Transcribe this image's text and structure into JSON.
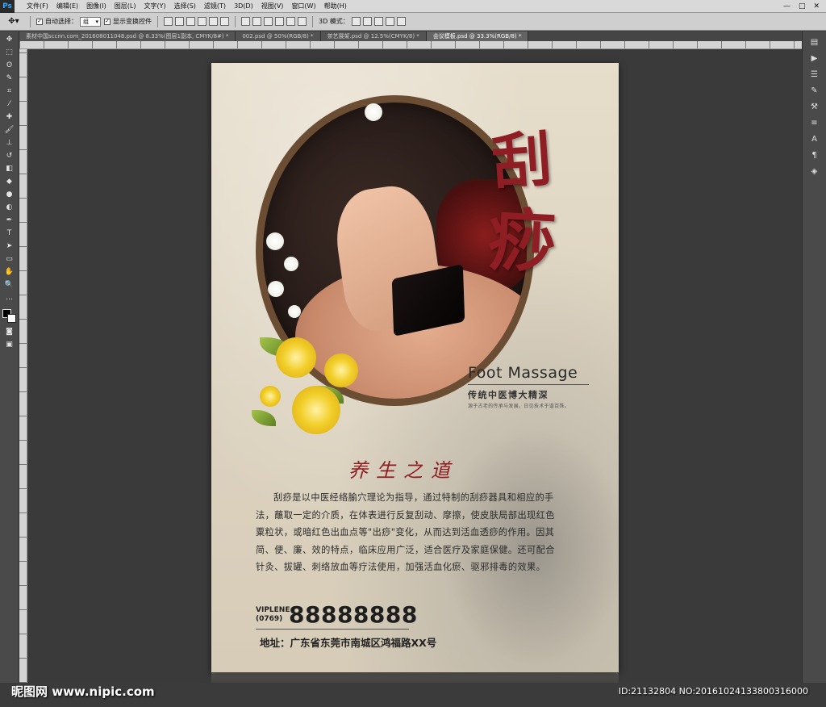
{
  "app": {
    "logo": "Ps"
  },
  "menu": [
    "文件(F)",
    "编辑(E)",
    "图像(I)",
    "图层(L)",
    "文字(Y)",
    "选择(S)",
    "滤镜(T)",
    "3D(D)",
    "视图(V)",
    "窗口(W)",
    "帮助(H)"
  ],
  "window_controls": [
    "—",
    "□",
    "✕"
  ],
  "options": {
    "auto_select_label": "自动选择：",
    "auto_select_value": "组",
    "show_transform_label": "显示变换控件",
    "mode_label": "3D 模式："
  },
  "tabs": [
    {
      "label": "素材中国sccnn.com_201608011048.psd @ 8.33%(图层1副本, CMYK/8#) *",
      "active": false
    },
    {
      "label": "002.psd @ 50%(RGB/8) *",
      "active": false
    },
    {
      "label": "茶艺展架.psd @ 12.5%(CMYK/8) *",
      "active": false
    },
    {
      "label": "会议模板.psd @ 33.3%(RGB/8) *",
      "active": true
    }
  ],
  "poster": {
    "title_char_1": "刮",
    "title_char_2": "痧",
    "english_title": "Foot Massage",
    "tagline": "传统中医博大精深",
    "tagline_sub": "源于古老的传承与发展，日见技术于谐百殊。",
    "section_title": "养生之道",
    "body_lines": [
      "刮痧是以中医经络腧穴理论为指导，通过特制的刮痧器具和相应的手",
      "法，蘸取一定的介质，在体表进行反复刮动、摩擦，使皮肤局部出现红色",
      "粟粒状，或暗红色出血点等\"出痧\"变化，从而达到活血透痧的作用。因其",
      "简、便、廉、效的特点，临床应用广泛，适合医疗及家庭保健。还可配合",
      "针灸、拔罐、刺络放血等疗法使用，加强活血化瘀、驱邪排毒的效果。"
    ],
    "phone_brand": "VIPLENE",
    "phone_area": "(0769)",
    "phone_number": "88888888",
    "address": "地址：广东省东莞市南城区鸿福路XX号"
  },
  "watermark": {
    "left": "昵图网 www.nipic.com",
    "right": "ID:21132804 NO:20161024133800316000"
  },
  "colors": {
    "accent_red": "#8f1d24",
    "frame_brown": "#6b4d33",
    "ui_dark": "#3b3b3b"
  }
}
